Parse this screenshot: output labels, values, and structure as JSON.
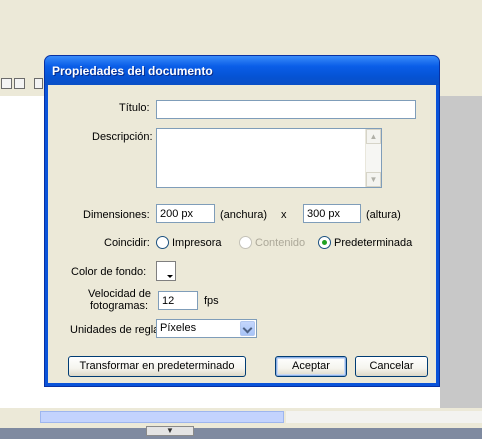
{
  "dialog": {
    "title": "Propiedades del documento",
    "fields": {
      "title_label": "Título:",
      "title_value": "",
      "description_label": "Descripción:",
      "description_value": "",
      "dimensions_label": "Dimensiones:",
      "width_value": "200 px",
      "width_unit": "(anchura)",
      "times": "x",
      "height_value": "300 px",
      "height_unit": "(altura)",
      "match_label": "Coincidir:",
      "match_options": [
        {
          "label": "Impresora",
          "selected": false,
          "enabled": true
        },
        {
          "label": "Contenido",
          "selected": false,
          "enabled": false
        },
        {
          "label": "Predeterminada",
          "selected": true,
          "enabled": true
        }
      ],
      "bg_color_label": "Color de fondo:",
      "bg_color": "#ffffff",
      "fps_label_line1": "Velocidad de",
      "fps_label_line2": "fotogramas:",
      "fps_value": "12",
      "fps_unit": "fps",
      "ruler_label": "Unidades de regla:",
      "ruler_value": "Píxeles"
    },
    "buttons": {
      "make_default": "Transformar en predeterminado",
      "ok": "Aceptar",
      "cancel": "Cancelar"
    }
  }
}
